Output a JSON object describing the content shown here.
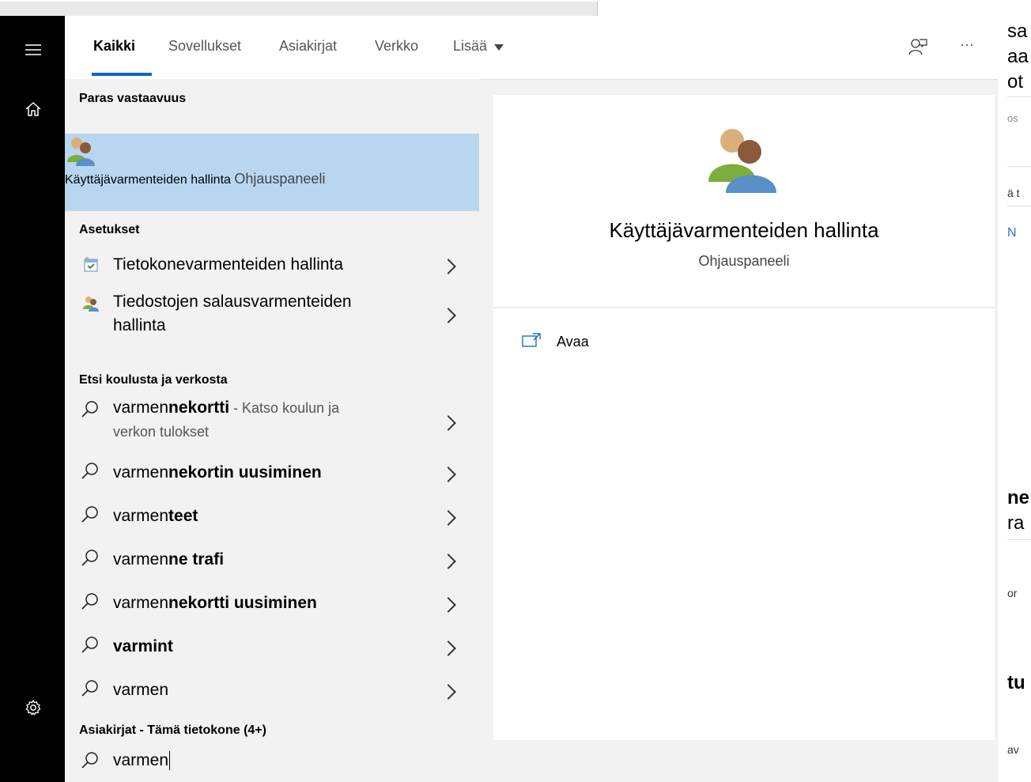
{
  "background_window": {
    "fragments": [
      "sa",
      "aa",
      "ot",
      "os",
      "ä t",
      "N",
      "ne",
      "ra",
      "or",
      "tu",
      "av"
    ]
  },
  "rail": {
    "menu_icon": "hamburger-menu-icon",
    "home_icon": "home-icon",
    "settings_icon": "gear-icon"
  },
  "tabs": {
    "items": [
      {
        "label": "Kaikki",
        "active": true
      },
      {
        "label": "Sovellukset"
      },
      {
        "label": "Asiakirjat"
      },
      {
        "label": "Verkko"
      },
      {
        "label": "Lisää"
      }
    ],
    "feedback_icon": "feedback-person-icon",
    "more_label": "···"
  },
  "best_match": {
    "section_title": "Paras vastaavuus",
    "title": "Käyttäjävarmenteiden hallinta",
    "subtitle": "Ohjauspaneeli"
  },
  "settings_section": {
    "title": "Asetukset",
    "items": [
      {
        "label": "Tietokonevarmenteiden hallinta"
      },
      {
        "label_line1": "Tiedostojen salausvarmenteiden",
        "label_line2": "hallinta"
      }
    ]
  },
  "web_section": {
    "title": "Etsi koulusta ja verkosta",
    "items": [
      {
        "prefix": "varmen",
        "bold": "nekortti",
        "suffix": " - Katso koulun ja",
        "line2": "verkon tulokset"
      },
      {
        "prefix": "varmen",
        "bold": "nekortin uusiminen"
      },
      {
        "prefix": "varmen",
        "bold": "teet"
      },
      {
        "prefix": "varmen",
        "bold": "ne trafi"
      },
      {
        "prefix": "varmen",
        "bold": "nekortti uusiminen"
      },
      {
        "prefix": "",
        "bold": "varmint"
      },
      {
        "prefix": "varmen",
        "bold": ""
      }
    ]
  },
  "documents_section": {
    "title": "Asiakirjat - Tämä tietokone (4+)"
  },
  "preview": {
    "title": "Käyttäjävarmenteiden hallinta",
    "subtitle": "Ohjauspaneeli",
    "action_label": "Avaa",
    "action_icon": "open-external-icon"
  },
  "search": {
    "icon": "search-icon",
    "query": "varmen"
  },
  "colors": {
    "rail": "#000000",
    "selection": "#b8d6f0",
    "accent": "#0a68c8",
    "panel_bg": "#f2f2f2"
  }
}
